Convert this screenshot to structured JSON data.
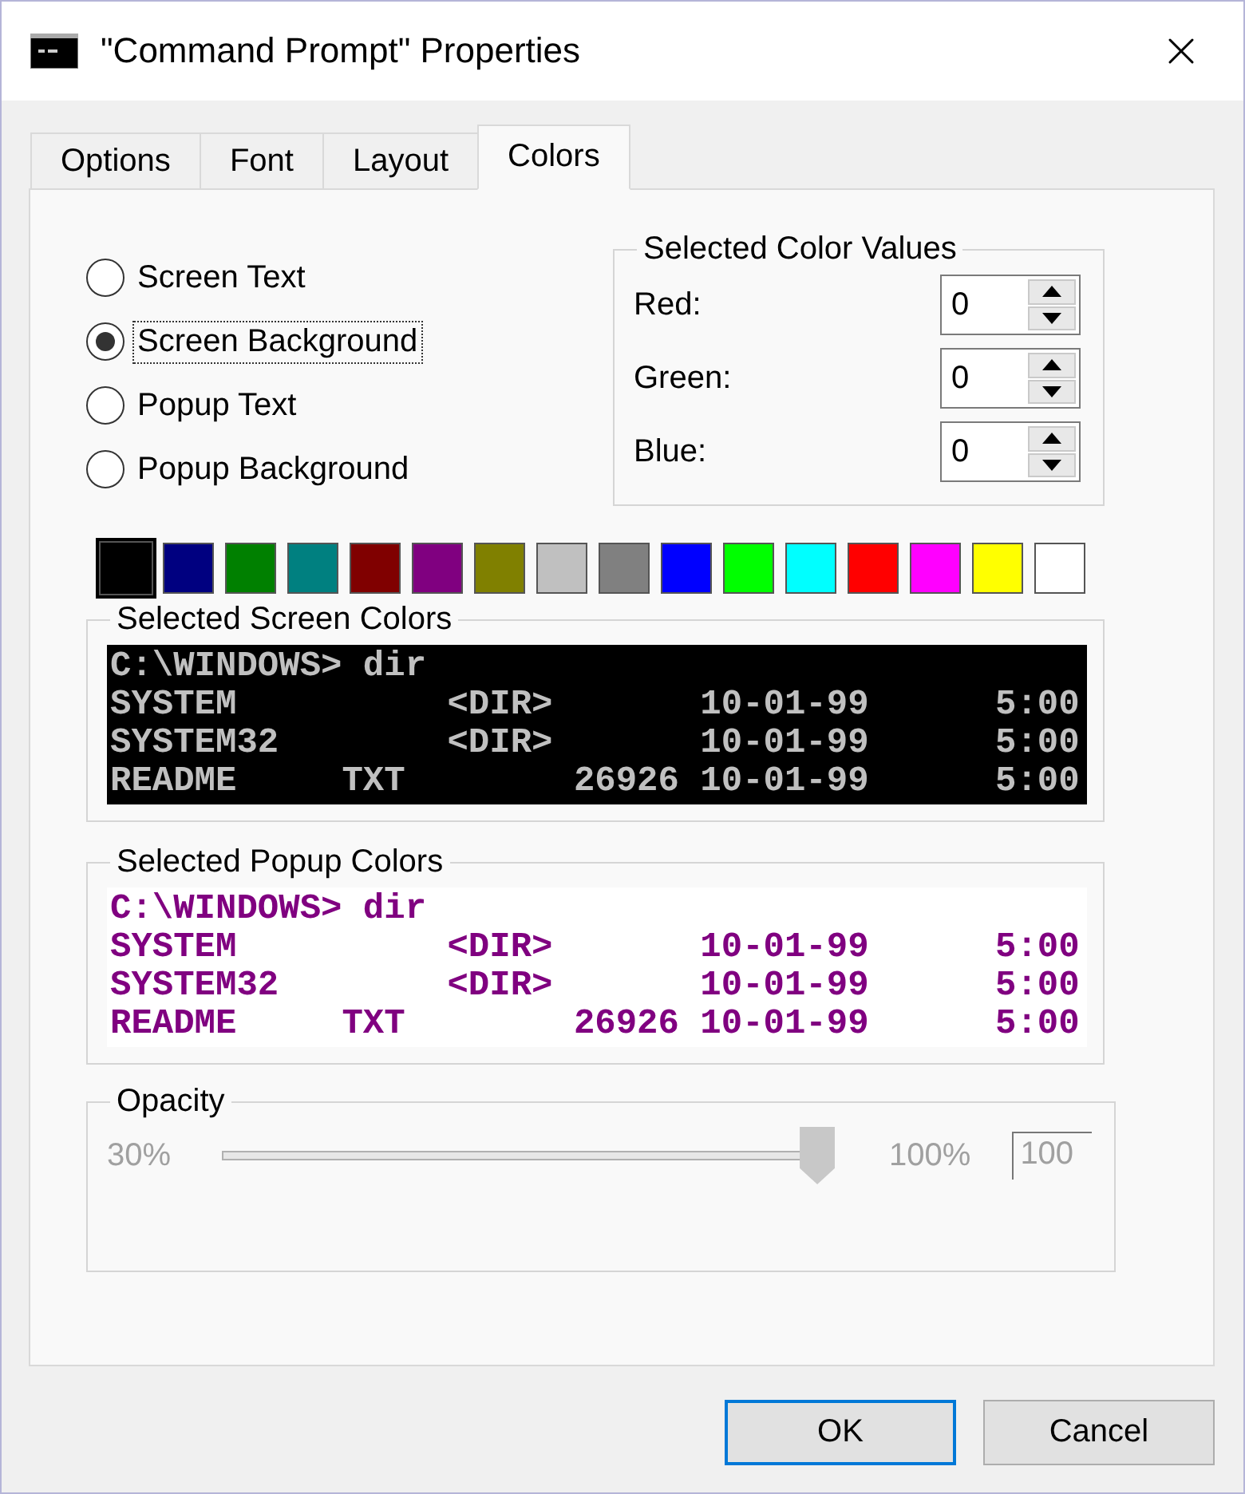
{
  "window": {
    "title": "\"Command Prompt\" Properties"
  },
  "tabs": [
    {
      "label": "Options",
      "selected": false
    },
    {
      "label": "Font",
      "selected": false
    },
    {
      "label": "Layout",
      "selected": false
    },
    {
      "label": "Colors",
      "selected": true
    }
  ],
  "color_targets": [
    {
      "label": "Screen Text",
      "selected": false
    },
    {
      "label": "Screen Background",
      "selected": true
    },
    {
      "label": "Popup Text",
      "selected": false
    },
    {
      "label": "Popup Background",
      "selected": false
    }
  ],
  "selected_color_values": {
    "title": "Selected Color Values",
    "fields": [
      {
        "label": "Red:",
        "value": "0"
      },
      {
        "label": "Green:",
        "value": "0"
      },
      {
        "label": "Blue:",
        "value": "0"
      }
    ]
  },
  "swatches": [
    {
      "color": "#000000",
      "selected": true
    },
    {
      "color": "#000080",
      "selected": false
    },
    {
      "color": "#008000",
      "selected": false
    },
    {
      "color": "#008080",
      "selected": false
    },
    {
      "color": "#800000",
      "selected": false
    },
    {
      "color": "#800080",
      "selected": false
    },
    {
      "color": "#808000",
      "selected": false
    },
    {
      "color": "#c0c0c0",
      "selected": false
    },
    {
      "color": "#808080",
      "selected": false
    },
    {
      "color": "#0000ff",
      "selected": false
    },
    {
      "color": "#00ff00",
      "selected": false
    },
    {
      "color": "#00ffff",
      "selected": false
    },
    {
      "color": "#ff0000",
      "selected": false
    },
    {
      "color": "#ff00ff",
      "selected": false
    },
    {
      "color": "#ffff00",
      "selected": false
    },
    {
      "color": "#ffffff",
      "selected": false
    }
  ],
  "screen_preview": {
    "title": "Selected Screen Colors",
    "lines": [
      "C:\\WINDOWS> dir",
      "SYSTEM          <DIR>       10-01-99      5:00",
      "SYSTEM32        <DIR>       10-01-99      5:00",
      "README     TXT        26926 10-01-99      5:00"
    ]
  },
  "popup_preview": {
    "title": "Selected Popup Colors",
    "lines": [
      "C:\\WINDOWS> dir",
      "SYSTEM          <DIR>       10-01-99      5:00",
      "SYSTEM32        <DIR>       10-01-99      5:00",
      "README     TXT        26926 10-01-99      5:00"
    ]
  },
  "opacity": {
    "title": "Opacity",
    "min_label": "30%",
    "max_label": "100%",
    "value": "100",
    "level": 1,
    "disabled": true
  },
  "buttons": [
    {
      "label": "OK",
      "default": true
    },
    {
      "label": "Cancel",
      "default": false
    }
  ]
}
